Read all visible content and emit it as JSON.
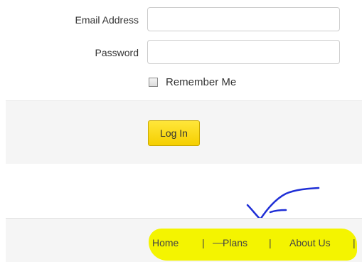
{
  "login_form": {
    "email_label": "Email Address",
    "email_value": "",
    "password_label": "Password",
    "password_value": "",
    "remember_label": "Remember Me",
    "remember_checked": false,
    "login_button": "Log In"
  },
  "footer": {
    "links": [
      "Home",
      "Plans",
      "About Us"
    ],
    "separator": "|",
    "highlight_color": "#f4f400"
  },
  "annotation": {
    "checkmark_icon": "hand-drawn-checkmark-icon",
    "ink_color": "#1f2fd6"
  }
}
